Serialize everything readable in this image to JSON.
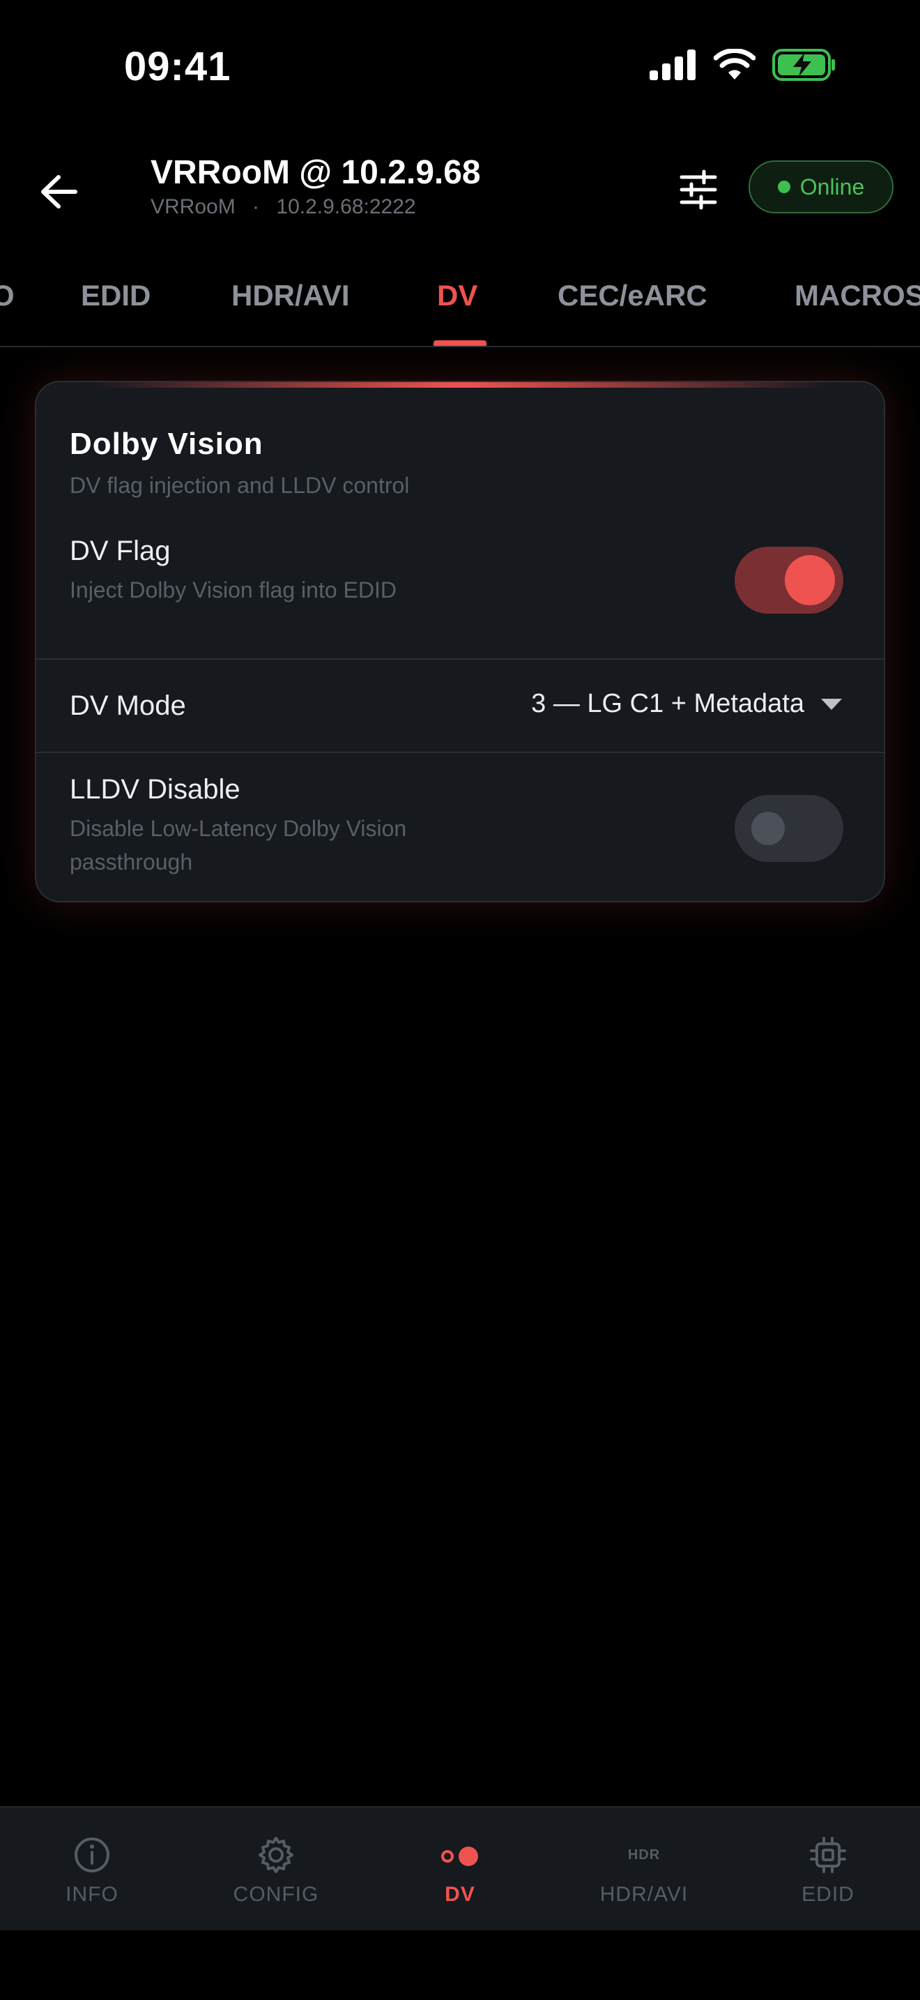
{
  "status_bar": {
    "time": "09:41"
  },
  "header": {
    "title": "VRRooM @ 10.2.9.68",
    "subtitle_name": "VRRooM",
    "subtitle_sep": "·",
    "subtitle_addr": "10.2.9.68:2222",
    "status_label": "Online"
  },
  "tabs": [
    {
      "label": "O"
    },
    {
      "label": "EDID"
    },
    {
      "label": "HDR/AVI"
    },
    {
      "label": "DV"
    },
    {
      "label": "CEC/eARC"
    },
    {
      "label": "MACROS"
    }
  ],
  "active_tab": "DV",
  "card": {
    "title": "Dolby Vision",
    "subtitle": "DV flag injection and LLDV control",
    "dv_flag": {
      "label": "DV Flag",
      "description": "Inject Dolby Vision flag into EDID",
      "enabled": true
    },
    "dv_mode": {
      "label": "DV Mode",
      "value": "3 — LG C1 + Metadata"
    },
    "lldv": {
      "label": "LLDV Disable",
      "description": "Disable Low-Latency Dolby Vision passthrough",
      "enabled": false
    }
  },
  "bottom_nav": [
    {
      "label": "INFO",
      "icon": "info-icon"
    },
    {
      "label": "CONFIG",
      "icon": "gear-icon"
    },
    {
      "label": "DV",
      "icon": "dv-dots-icon"
    },
    {
      "label": "HDR/AVI",
      "icon": "hdr-icon",
      "icon_text": "HDR"
    },
    {
      "label": "EDID",
      "icon": "chip-icon"
    }
  ],
  "colors": {
    "accent": "#ef5350",
    "online": "#4cc15c",
    "background": "#000000",
    "card": "#16191e"
  }
}
